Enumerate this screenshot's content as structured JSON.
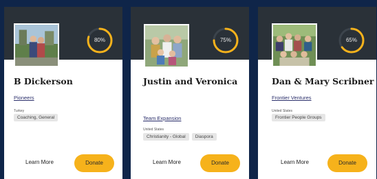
{
  "cards": [
    {
      "name": "B Dickerson",
      "role": "Pioneers",
      "location": "Turkey",
      "tags": [
        "Coaching, General"
      ],
      "progress_percent": 80,
      "progress_label": "80%",
      "learn_more": "Learn More",
      "donate": "Donate"
    },
    {
      "name": "Justin and Veronica",
      "role": "Team Expansion",
      "location": "United States",
      "tags": [
        "Christianity - Global",
        "Diaspora"
      ],
      "progress_percent": 75,
      "progress_label": "75%",
      "learn_more": "Learn More",
      "donate": "Donate"
    },
    {
      "name": "Dan & Mary Scribner",
      "role": "Frontier Ventures",
      "location": "United States",
      "tags": [
        "Frontier People Groups"
      ],
      "progress_percent": 65,
      "progress_label": "65%",
      "learn_more": "Learn More",
      "donate": "Donate"
    }
  ],
  "colors": {
    "page_background": "#0f2549",
    "card_header": "#2a3138",
    "progress_ring": "#f6b21b",
    "donate_button": "#f6b21b",
    "role_link": "#2b2f6b"
  }
}
